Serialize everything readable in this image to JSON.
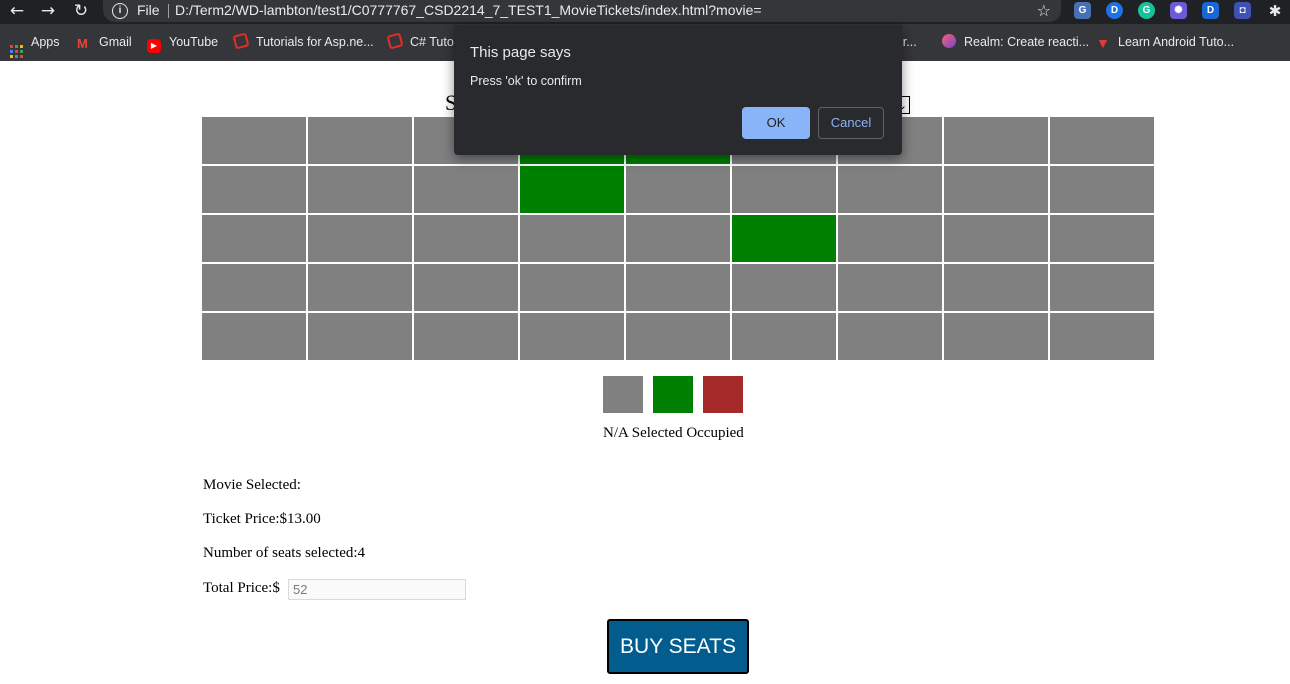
{
  "browser": {
    "file_label": "File",
    "url": "D:/Term2/WD-lambton/test1/C0777767_CSD2214_7_TEST1_MovieTickets/index.html?movie=",
    "extensions": [
      {
        "label": "G",
        "color": "#4a6fb5"
      },
      {
        "label": "D",
        "color": "#1a73e8"
      },
      {
        "label": "G",
        "color": "#15c39a"
      },
      {
        "label": "✺",
        "color": "#6b5bd6"
      },
      {
        "label": "D",
        "color": "#1967d2"
      },
      {
        "label": "◘",
        "color": "#3f51b5"
      }
    ]
  },
  "bookmarks": [
    {
      "label": "Apps",
      "icon": "apps-grid-icon"
    },
    {
      "label": "Gmail",
      "icon": "gmail-icon",
      "color": "#ea4335"
    },
    {
      "label": "YouTube",
      "icon": "youtube-icon",
      "color": "#ff0000"
    },
    {
      "label": "Tutorials for Asp.ne...",
      "icon": "bookmark-site-icon",
      "color": "#e52d27"
    },
    {
      "label": "C# Tuto",
      "icon": "bookmark-site-icon",
      "color": "#e52d27"
    },
    {
      "label": "lr...",
      "icon": "bookmark-site-icon"
    },
    {
      "label": "Realm: Create reacti...",
      "icon": "realm-icon",
      "color": "#f2617a"
    },
    {
      "label": "Learn Android Tuto...",
      "icon": "vue-logo-icon",
      "color": "#e53935"
    }
  ],
  "page": {
    "heading_fragment": "S",
    "select_arrow": "⌄",
    "seats": {
      "rows": 5,
      "cols": 9,
      "selected": [
        [
          0,
          3
        ],
        [
          0,
          4
        ],
        [
          1,
          3
        ],
        [
          2,
          5
        ]
      ],
      "colors": {
        "na": "#808080",
        "selected": "#008000",
        "occupied": "#a52a2a"
      }
    },
    "legend_label": "N/A Selected Occupied",
    "movie_selected": "Movie Selected:",
    "ticket_price": "Ticket Price:$13.00",
    "seats_selected": "Number of seats selected:4",
    "total_label": "Total Price:$",
    "total_value": "52",
    "buy_button": "BUY SEATS"
  },
  "dialog": {
    "title": "This page says",
    "message": "Press 'ok' to confirm",
    "ok": "OK",
    "cancel": "Cancel"
  }
}
